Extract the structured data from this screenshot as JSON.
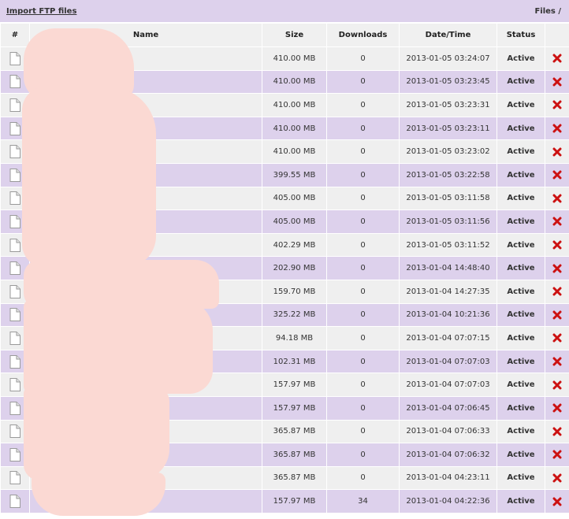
{
  "header": {
    "import_link": "Import FTP files",
    "breadcrumb": "Files /"
  },
  "table": {
    "columns": [
      "#",
      "Name",
      "Size",
      "Downloads",
      "Date/Time",
      "Status",
      ""
    ],
    "rows": [
      {
        "size": "410.00 MB",
        "downloads": "0",
        "datetime": "2013-01-05 03:24:07",
        "status": "Active"
      },
      {
        "size": "410.00 MB",
        "downloads": "0",
        "datetime": "2013-01-05 03:23:45",
        "status": "Active"
      },
      {
        "size": "410.00 MB",
        "downloads": "0",
        "datetime": "2013-01-05 03:23:31",
        "status": "Active"
      },
      {
        "size": "410.00 MB",
        "downloads": "0",
        "datetime": "2013-01-05 03:23:11",
        "status": "Active"
      },
      {
        "size": "410.00 MB",
        "downloads": "0",
        "datetime": "2013-01-05 03:23:02",
        "status": "Active"
      },
      {
        "size": "399.55 MB",
        "downloads": "0",
        "datetime": "2013-01-05 03:22:58",
        "status": "Active"
      },
      {
        "size": "405.00 MB",
        "downloads": "0",
        "datetime": "2013-01-05 03:11:58",
        "status": "Active"
      },
      {
        "size": "405.00 MB",
        "downloads": "0",
        "datetime": "2013-01-05 03:11:56",
        "status": "Active"
      },
      {
        "size": "402.29 MB",
        "downloads": "0",
        "datetime": "2013-01-05 03:11:52",
        "status": "Active"
      },
      {
        "size": "202.90 MB",
        "downloads": "0",
        "datetime": "2013-01-04 14:48:40",
        "status": "Active"
      },
      {
        "size": "159.70 MB",
        "downloads": "0",
        "datetime": "2013-01-04 14:27:35",
        "status": "Active"
      },
      {
        "size": "325.22 MB",
        "downloads": "0",
        "datetime": "2013-01-04 10:21:36",
        "status": "Active"
      },
      {
        "size": "94.18 MB",
        "downloads": "0",
        "datetime": "2013-01-04 07:07:15",
        "status": "Active"
      },
      {
        "size": "102.31 MB",
        "downloads": "0",
        "datetime": "2013-01-04 07:07:03",
        "status": "Active"
      },
      {
        "size": "157.97 MB",
        "downloads": "0",
        "datetime": "2013-01-04 07:07:03",
        "status": "Active"
      },
      {
        "size": "157.97 MB",
        "downloads": "0",
        "datetime": "2013-01-04 07:06:45",
        "status": "Active"
      },
      {
        "size": "365.87 MB",
        "downloads": "0",
        "datetime": "2013-01-04 07:06:33",
        "status": "Active"
      },
      {
        "size": "365.87 MB",
        "downloads": "0",
        "datetime": "2013-01-04 07:06:32",
        "status": "Active"
      },
      {
        "size": "365.87 MB",
        "downloads": "0",
        "datetime": "2013-01-04 04:23:11",
        "status": "Active"
      },
      {
        "size": "157.97 MB",
        "downloads": "34",
        "datetime": "2013-01-04 04:22:36",
        "status": "Active"
      }
    ]
  },
  "icons": {
    "file": "file-icon",
    "delete": "delete-icon"
  },
  "colors": {
    "header_bar": "#ddd1ec",
    "row_odd": "#efefef",
    "row_even": "#ddd1ec",
    "status_active": "#119911",
    "delete": "#cc1111",
    "redaction": "#fbd9d3"
  }
}
